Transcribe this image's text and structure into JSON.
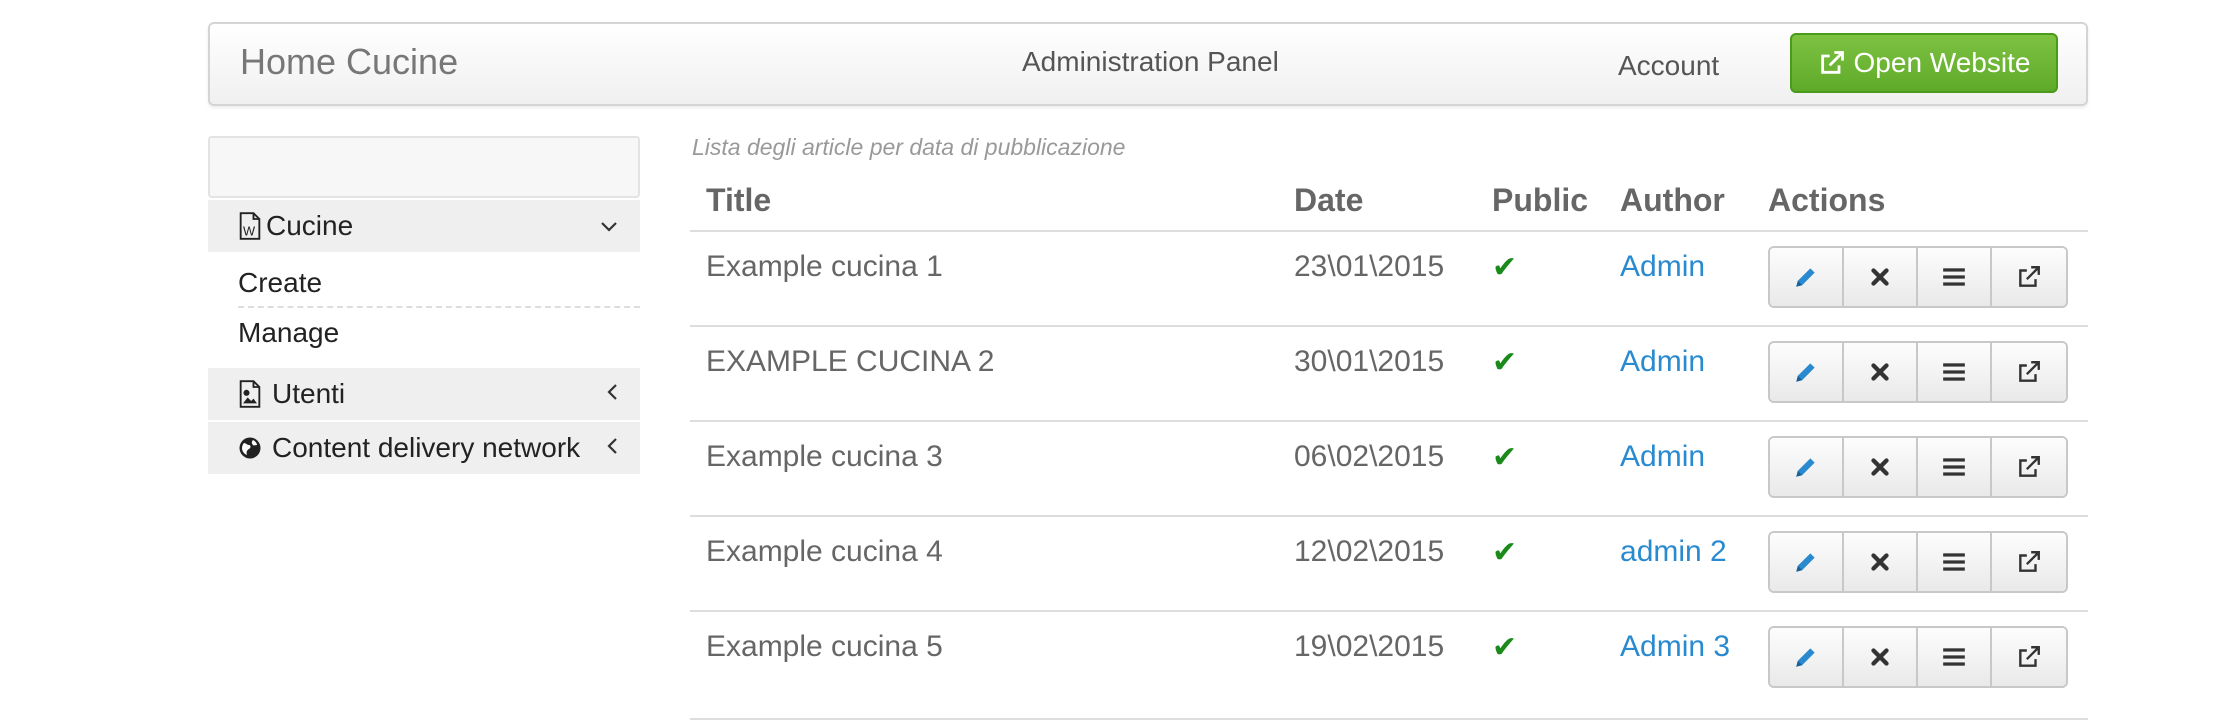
{
  "navbar": {
    "brand": "Home Cucine",
    "center": "Administration Panel",
    "account": "Account",
    "open_website": "Open Website"
  },
  "sidebar": {
    "cucine": {
      "label": "Cucine",
      "icon": "word-file-icon",
      "chevron": "chevron-down-icon"
    },
    "cucine_items": [
      "Create",
      "Manage"
    ],
    "utenti": {
      "label": "Utenti",
      "icon": "image-file-icon",
      "chevron": "chevron-left-icon"
    },
    "cdn": {
      "label": "Content delivery network",
      "icon": "globe-icon",
      "chevron": "chevron-left-icon"
    }
  },
  "main": {
    "caption": "Lista degli article per data di pubblicazione",
    "columns": [
      "Title",
      "Date",
      "Public",
      "Author",
      "Actions"
    ],
    "rows": [
      {
        "title": "Example cucina 1",
        "date": "23\\01\\2015",
        "public": "✔",
        "author": "Admin"
      },
      {
        "title": "EXAMPLE CUCINA 2",
        "date": "30\\01\\2015",
        "public": "✔",
        "author": "Admin"
      },
      {
        "title": "Example cucina 3",
        "date": "06\\02\\2015",
        "public": "✔",
        "author": "Admin"
      },
      {
        "title": "Example cucina 4",
        "date": "12\\02\\2015",
        "public": "✔",
        "author": "admin 2"
      },
      {
        "title": "Example cucina 5",
        "date": "19\\02\\2015",
        "public": "✔",
        "author": "Admin 3"
      }
    ],
    "actions": [
      "edit-icon",
      "delete-icon",
      "list-icon",
      "external-link-icon"
    ]
  },
  "colors": {
    "accent_green": "#6cb533",
    "link_blue": "#2a8ad0",
    "check_green": "#1a8a1a"
  }
}
